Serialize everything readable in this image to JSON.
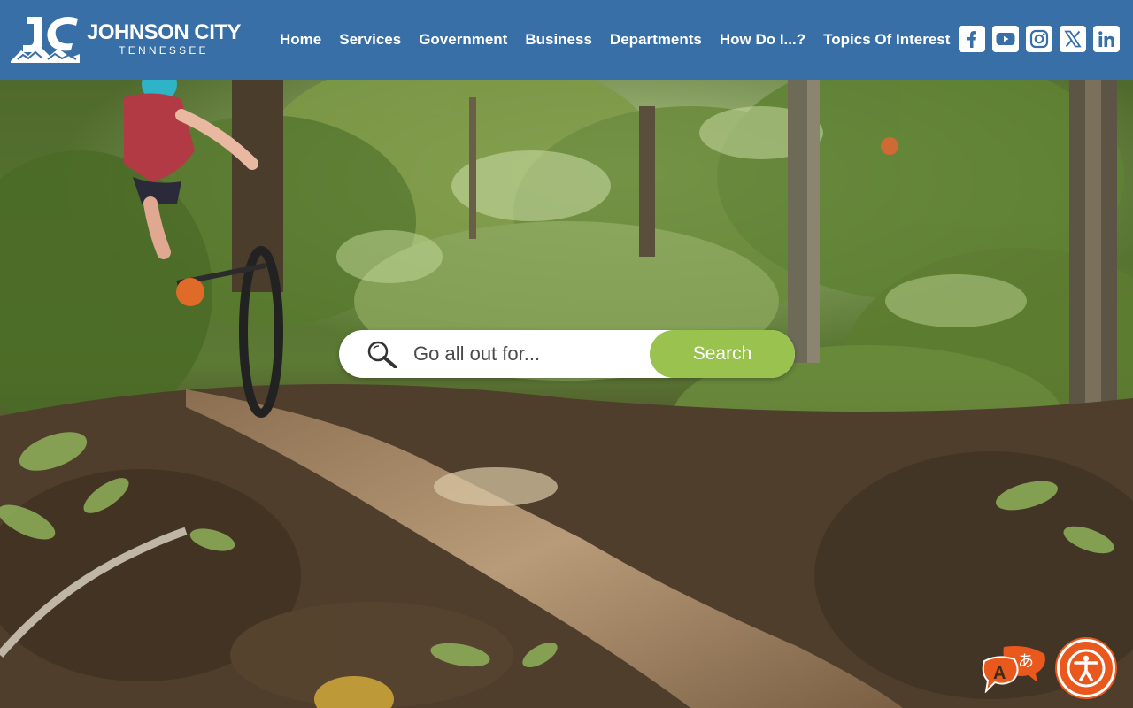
{
  "brand": {
    "title": "JOHNSON CITY",
    "subtitle": "TENNESSEE",
    "logo_icon": "jc-mountain-logo"
  },
  "nav": {
    "items": [
      {
        "label": "Home"
      },
      {
        "label": "Services"
      },
      {
        "label": "Government"
      },
      {
        "label": "Business"
      },
      {
        "label": "Departments"
      },
      {
        "label": "How Do I...?"
      },
      {
        "label": "Topics Of Interest"
      }
    ]
  },
  "social": {
    "icons": [
      "facebook-icon",
      "youtube-icon",
      "instagram-icon",
      "x-icon",
      "linkedin-icon"
    ]
  },
  "search": {
    "placeholder": "Go all out for...",
    "button_label": "Search"
  },
  "widgets": {
    "translate_icon": "translate-icon",
    "accessibility_icon": "accessibility-icon"
  },
  "colors": {
    "header": "#376fa6",
    "search_button": "#9ac24e",
    "accessibility": "#e9591d"
  }
}
